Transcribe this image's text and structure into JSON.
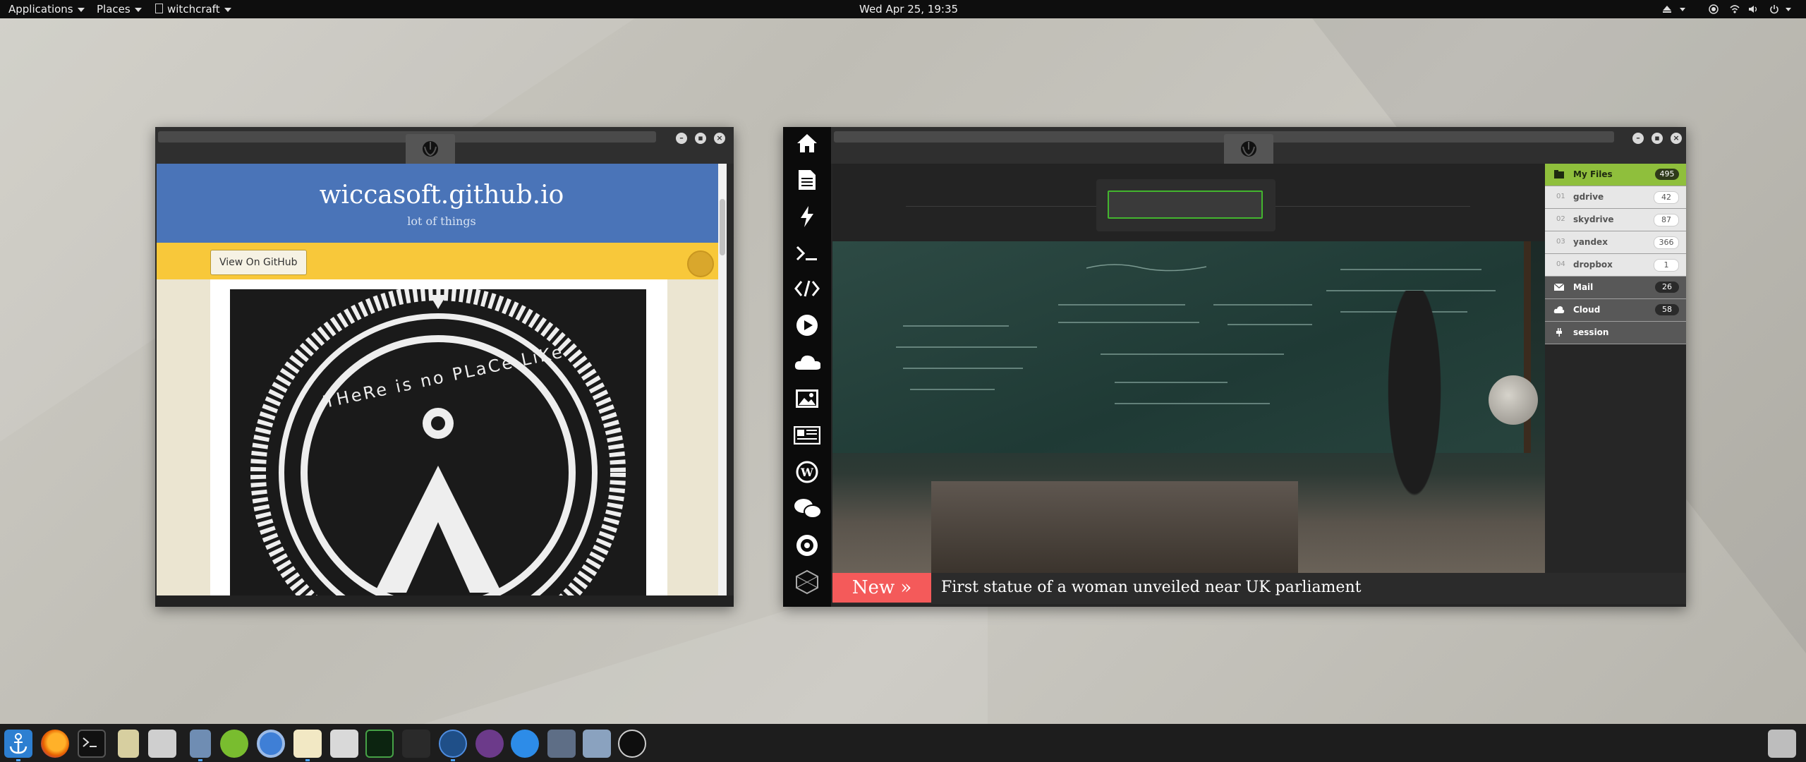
{
  "topbar": {
    "applications": "Applications",
    "places": "Places",
    "active_app": "witchcraft",
    "clock": "Wed Apr 25, 19:35"
  },
  "window_left": {
    "site_title": "wiccasoft.github.io",
    "site_subtitle": "lot of things",
    "github_button": "View On GitHub",
    "image_text": "THeRe is no PLaCe LiKe"
  },
  "window_right": {
    "sidebar_icons": [
      "home-icon",
      "document-icon",
      "lightning-icon",
      "terminal-icon",
      "code-icon",
      "play-icon",
      "cloud-icon",
      "image-icon",
      "news-icon",
      "wordpress-icon",
      "chat-icon",
      "empire-icon",
      "hex-icon"
    ],
    "search": {
      "value": "",
      "placeholder": ""
    },
    "ticker": {
      "badge": "New »",
      "headline": "First statue of a woman unveiled near UK parliament"
    },
    "files": [
      {
        "num": "",
        "label": "My Files",
        "count": "495",
        "style": "green"
      },
      {
        "num": "01",
        "label": "gdrive",
        "count": "42",
        "style": "light"
      },
      {
        "num": "02",
        "label": "skydrive",
        "count": "87",
        "style": "light"
      },
      {
        "num": "03",
        "label": "yandex",
        "count": "366",
        "style": "light"
      },
      {
        "num": "04",
        "label": "dropbox",
        "count": "1",
        "style": "light"
      },
      {
        "num": "",
        "label": "Mail",
        "count": "26",
        "style": "dark"
      },
      {
        "num": "",
        "label": "Cloud",
        "count": "58",
        "style": "dark"
      },
      {
        "num": "",
        "label": "session",
        "count": "",
        "style": "dark"
      }
    ]
  },
  "taskbar": {
    "apps": [
      "anchor-icon",
      "firefox-icon",
      "terminal-icon",
      "clock-badge-icon",
      "keyboard-icon",
      "file-cabinet-icon",
      "cloud-sync-icon",
      "chromium-icon",
      "notes-icon",
      "calculator-icon",
      "system-monitor-icon",
      "camera-icon",
      "browser-icon",
      "media-player-icon",
      "chat-icon",
      "screenshot-icon",
      "archive-icon",
      "clock-icon",
      "trash-icon"
    ]
  }
}
